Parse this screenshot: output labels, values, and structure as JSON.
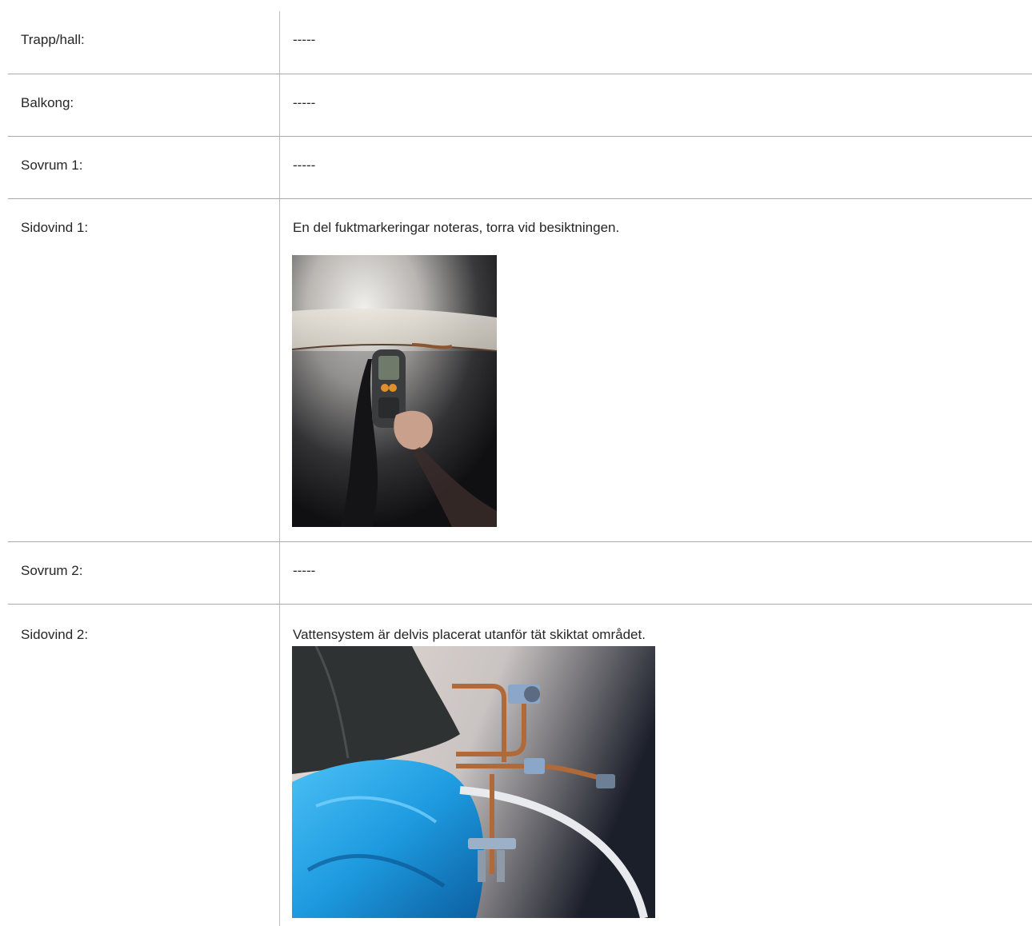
{
  "rows": [
    {
      "label": "Trapp/hall:",
      "value": "-----"
    },
    {
      "label": "Balkong:",
      "value": "-----"
    },
    {
      "label": "Sovrum 1:",
      "value": "-----"
    },
    {
      "label": "Sidovind 1:",
      "value": "En del fuktmarkeringar noteras, torra vid besiktningen."
    },
    {
      "label": "Sovrum 2:",
      "value": "-----"
    },
    {
      "label": "Sidovind 2:",
      "value": "Vattensystem är delvis placerat utanför tät skiktat området."
    }
  ],
  "photos": {
    "moisture_meter": {
      "icon": "moisture-meter-photo"
    },
    "water_pipes": {
      "icon": "water-pipes-photo"
    }
  },
  "colors": {
    "divider": "#a8a8a8",
    "text": "#262626",
    "plastic_blue": "#1e9be0",
    "copper": "#b06a3a"
  }
}
